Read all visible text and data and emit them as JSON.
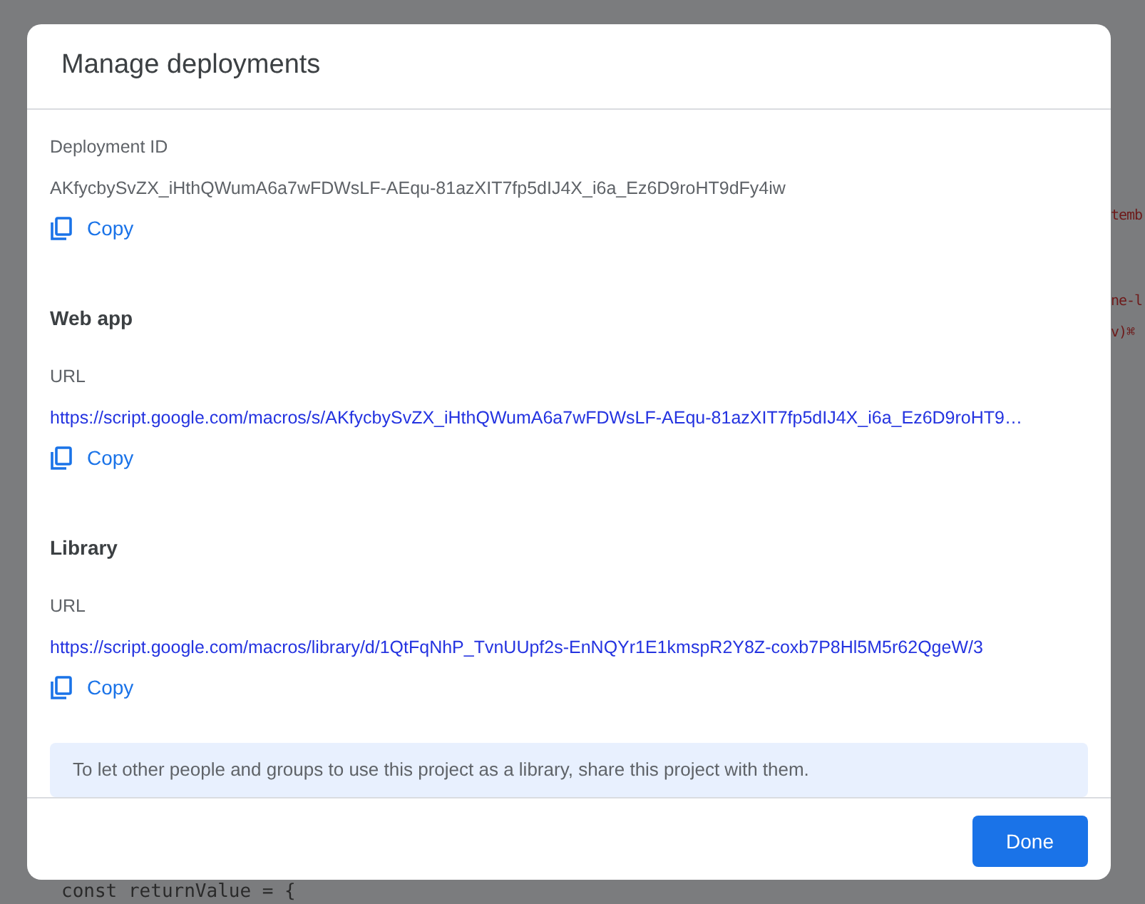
{
  "backdrop": {
    "fragments": [
      {
        "text": "temb",
        "kind": "code"
      },
      {
        "text": "ne-l",
        "kind": "code"
      },
      {
        "text": "v)⌘",
        "kind": "code"
      },
      {
        "text": "const returnValue = {",
        "kind": "bottom"
      }
    ]
  },
  "dialog": {
    "title": "Manage deployments",
    "sections": [
      {
        "kind": "id",
        "label": "Deployment ID",
        "value": "AKfycbySvZX_iHthQWumA6a7wFDWsLF-AEqu-81azXIT7fp5dIJ4X_i6a_Ez6D9roHT9dFy4iw",
        "copy": "Copy"
      },
      {
        "kind": "url",
        "heading": "Web app",
        "label": "URL",
        "value": "https://script.google.com/macros/s/AKfycbySvZX_iHthQWumA6a7wFDWsLF-AEqu-81azXIT7fp5dIJ4X_i6a_Ez6D9roHT9…",
        "copy": "Copy"
      },
      {
        "kind": "url",
        "heading": "Library",
        "label": "URL",
        "value": "https://script.google.com/macros/library/d/1QtFqNhP_TvnUUpf2s-EnNQYr1E1kmspR2Y8Z-coxb7P8Hl5M5r62QgeW/3",
        "copy": "Copy"
      }
    ],
    "note": "To let other people and groups to use this project as a library, share this project with them.",
    "buttons": [
      {
        "label": "Done"
      }
    ]
  }
}
